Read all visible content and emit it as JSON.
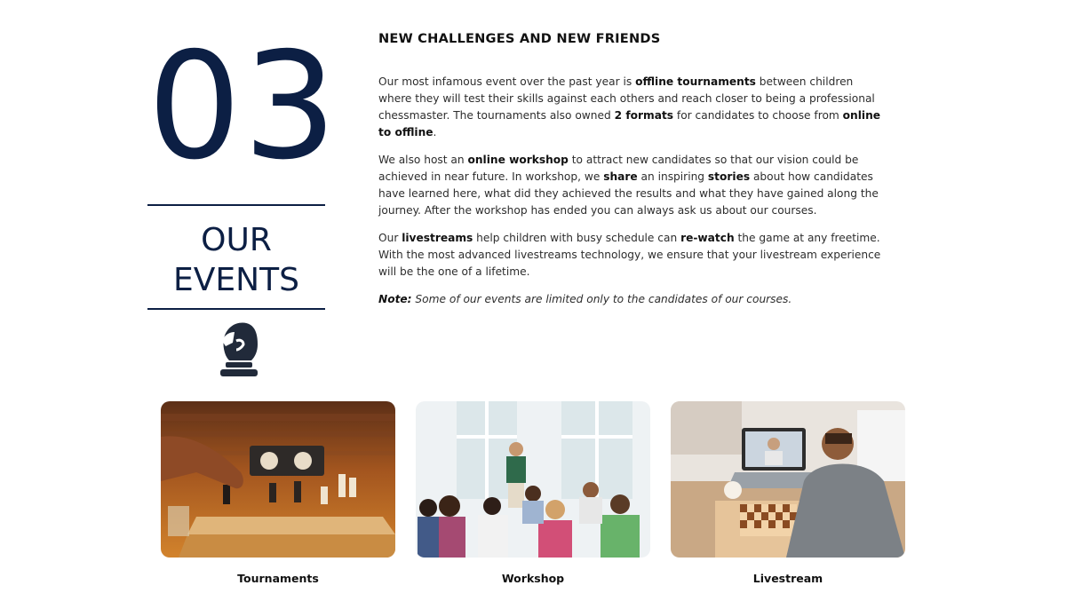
{
  "section": {
    "number": "03",
    "title_line1": "OUR",
    "title_line2": "EVENTS",
    "icon": "chess-knight-icon"
  },
  "content": {
    "heading": "NEW CHALLENGES AND NEW FRIENDS",
    "p1": [
      {
        "text": "Our most infamous event over the past year is ",
        "bold": false
      },
      {
        "text": "offline tournaments",
        "bold": true
      },
      {
        "text": " between children where they will test their skills against each others and reach closer to being a professional chessmaster. The tournaments also owned ",
        "bold": false
      },
      {
        "text": "2 formats",
        "bold": true
      },
      {
        "text": " for candidates to choose from ",
        "bold": false
      },
      {
        "text": "online to offline",
        "bold": true
      },
      {
        "text": ".",
        "bold": false
      }
    ],
    "p2": [
      {
        "text": "We also host an ",
        "bold": false
      },
      {
        "text": "online workshop",
        "bold": true
      },
      {
        "text": " to attract new candidates so that our vision could be achieved in near future. In workshop, we ",
        "bold": false
      },
      {
        "text": "share",
        "bold": true
      },
      {
        "text": " an inspiring ",
        "bold": false
      },
      {
        "text": "stories",
        "bold": true
      },
      {
        "text": " about how candidates have learned here, what did they achieved the results and what they have gained along the journey. After the workshop has ended you can always ask us about our courses.",
        "bold": false
      }
    ],
    "p3": [
      {
        "text": "Our ",
        "bold": false
      },
      {
        "text": "livestreams",
        "bold": true
      },
      {
        "text": " help children with busy schedule can ",
        "bold": false
      },
      {
        "text": "re-watch",
        "bold": true
      },
      {
        "text": " the game at any freetime. With the most advanced livestreams technology, we ensure that your livestream experience will be the one of a lifetime.",
        "bold": false
      }
    ],
    "note_label": "Note:",
    "note_text": " Some of our events are limited only to the candidates of our courses."
  },
  "cards": [
    {
      "label": "Tournaments",
      "image": "chess-tournament-photo"
    },
    {
      "label": "Workshop",
      "image": "workshop-audience-photo"
    },
    {
      "label": "Livestream",
      "image": "livestream-laptop-photo"
    }
  ],
  "colors": {
    "navy": "#0c1f44",
    "text": "#2d2d2d",
    "heading": "#111111"
  }
}
